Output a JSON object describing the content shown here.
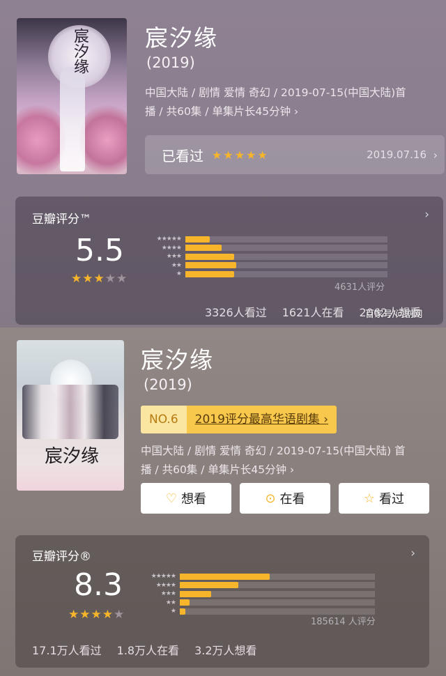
{
  "top": {
    "title": "宸汐缘",
    "year": "(2019)",
    "meta_line1": "中国大陆 / 剧情 爱情 奇幻 / 2019-07-15(中国大陆)首",
    "meta_line2": "播 / 共60集 / 单集片长45分钟 ›",
    "watched": {
      "label": "已看过",
      "stars": "★★★★★",
      "date": "2019.07.16",
      "chevron": "›"
    },
    "rating": {
      "title": "豆瓣评分™",
      "score": "5.5",
      "stars_on": "★★★",
      "stars_off": "★★",
      "distribution": [
        0.12,
        0.18,
        0.24,
        0.25,
        0.24
      ],
      "count": "4631人评分",
      "stats": [
        "3326人看过",
        "1621人在看",
        "2062人想看"
      ],
      "chevron": "›"
    }
  },
  "watermark": "百家号/问剧网",
  "bottom": {
    "title": "宸汐缘",
    "year": "(2019)",
    "rank_no": "NO.6",
    "rank_text": "2019评分最高华语剧集 ›",
    "meta_line1": "中国大陆 / 剧情 爱情 奇幻 / 2019-07-15(中国大陆) 首",
    "meta_line2": "播 / 共60集 / 单集片长45分钟 ›",
    "buttons": {
      "want": {
        "icon": "♡",
        "label": "想看"
      },
      "watching": {
        "icon": "⊙",
        "label": "在看"
      },
      "watched": {
        "icon": "☆",
        "label": "看过"
      }
    },
    "rating": {
      "title": "豆瓣评分®",
      "score": "8.3",
      "stars_on": "★★★★",
      "stars_off": "★",
      "distribution": [
        0.46,
        0.3,
        0.16,
        0.05,
        0.03
      ],
      "count": "185614 人评分",
      "stats": [
        "17.1万人看过",
        "1.8万人在看",
        "3.2万人想看"
      ],
      "chevron": "›"
    }
  },
  "colors": {
    "accent": "#f6b52b",
    "badge_light": "#fbe6a1",
    "badge_dark": "#f7c84c"
  }
}
